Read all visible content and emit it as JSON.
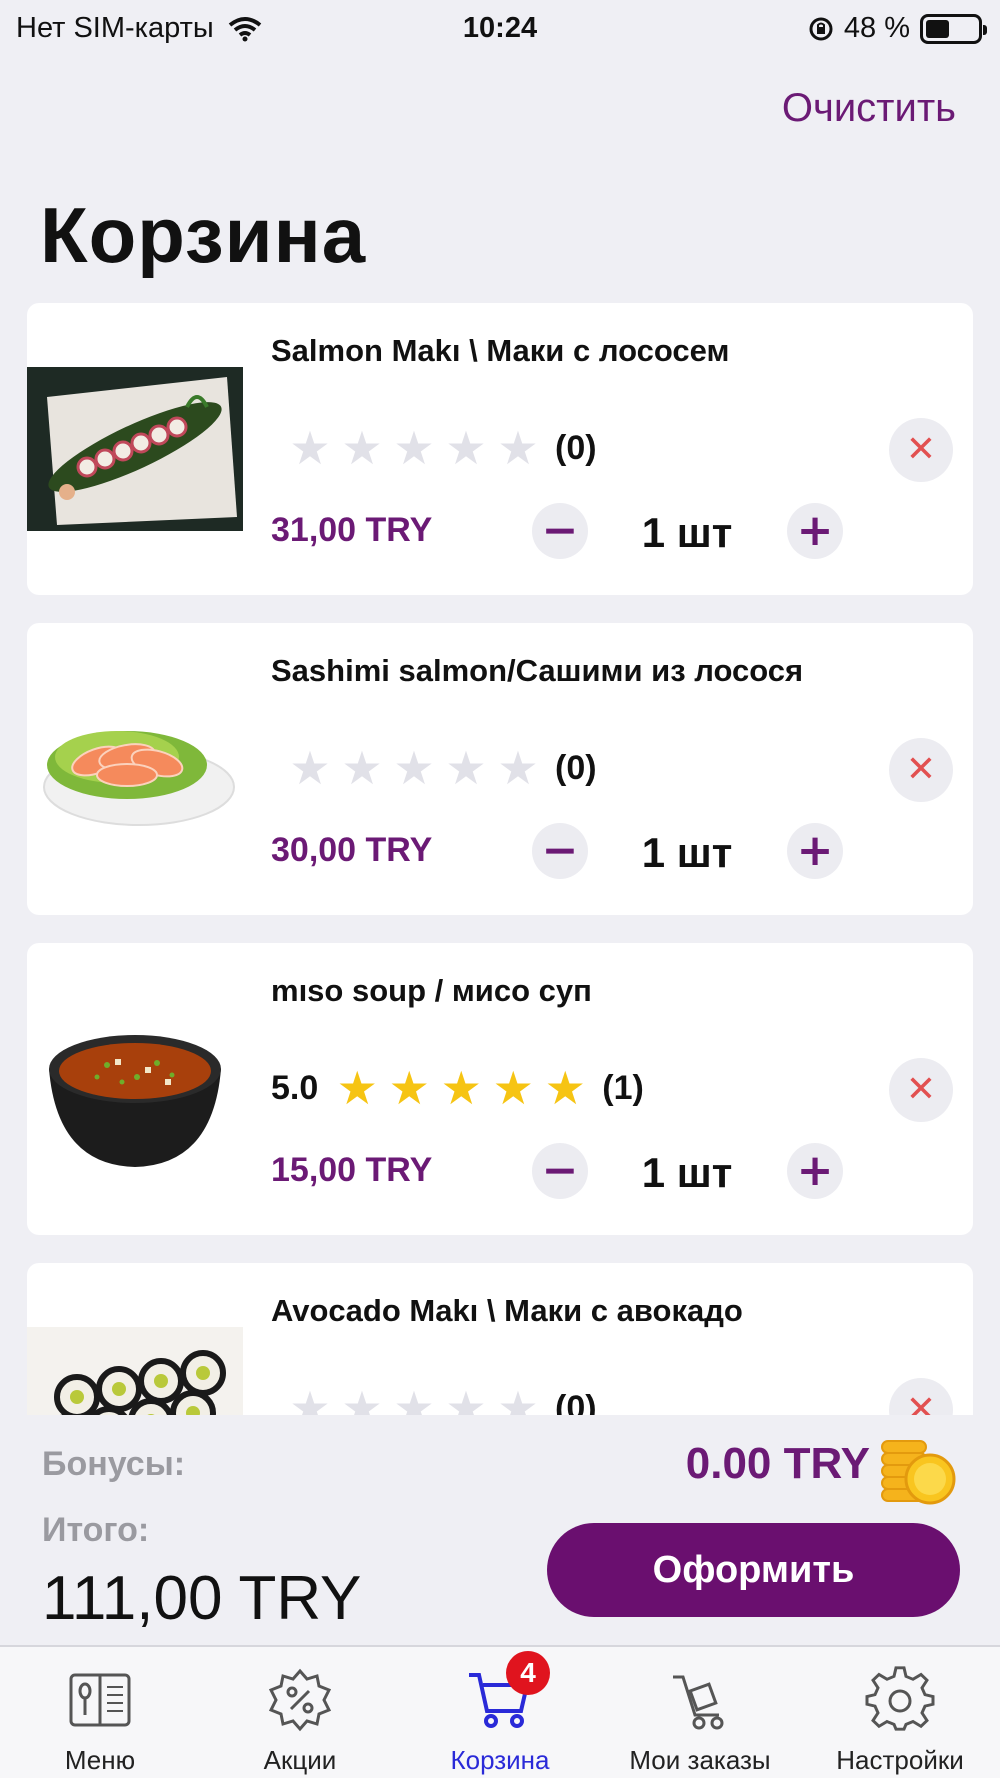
{
  "status_bar": {
    "carrier": "Нет SIM-карты",
    "time": "10:24",
    "battery": "48 %",
    "icons": [
      "wifi-icon",
      "orientation-lock-icon",
      "battery-icon"
    ]
  },
  "header": {
    "clear_label": "Очистить",
    "title": "Корзина"
  },
  "items": [
    {
      "name": "Salmon Makı \\ Маки с лососем",
      "rating_score": "",
      "rating_value": 0,
      "rating_count": "(0)",
      "price": "31,00 TRY",
      "quantity": "1 шт",
      "image": "salmon-maki-photo"
    },
    {
      "name": "Sashimi salmon/Сашими из лосося",
      "rating_score": "",
      "rating_value": 0,
      "rating_count": "(0)",
      "price": "30,00 TRY",
      "quantity": "1 шт",
      "image": "sashimi-photo"
    },
    {
      "name": "mıso soup / мисо суп",
      "rating_score": "5.0",
      "rating_value": 5,
      "rating_count": "(1)",
      "price": "15,00 TRY",
      "quantity": "1 шт",
      "image": "miso-soup-photo"
    },
    {
      "name": "Avocado Makı \\ Маки с авокадо",
      "rating_score": "",
      "rating_value": 0,
      "rating_count": "(0)",
      "price": "",
      "quantity": "",
      "image": "avocado-maki-photo"
    }
  ],
  "controls": {
    "minus": "−",
    "plus": "+",
    "remove": "✕",
    "star": "★"
  },
  "summary": {
    "bonus_label": "Бонусы:",
    "bonus_value": "0.00 TRY",
    "total_label": "Итого:",
    "total_value": "111,00 TRY",
    "checkout_label": "Оформить"
  },
  "tabbar": {
    "tabs": [
      {
        "label": "Меню",
        "icon": "menu-book-icon"
      },
      {
        "label": "Акции",
        "icon": "discount-icon"
      },
      {
        "label": "Корзина",
        "icon": "cart-icon",
        "badge": "4",
        "active": true
      },
      {
        "label": "Мои заказы",
        "icon": "orders-cart-icon"
      },
      {
        "label": "Настройки",
        "icon": "gear-icon"
      }
    ]
  },
  "colors": {
    "accent": "#6b1a75",
    "checkout": "#6a0f6f",
    "active_tab": "#2a2ad8",
    "star_on": "#f6c413",
    "star_off": "#e1e1e8",
    "remove": "#e25050",
    "badge": "#e0141e"
  }
}
